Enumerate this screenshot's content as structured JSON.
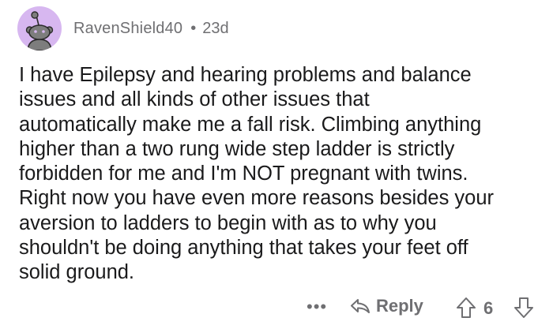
{
  "comment": {
    "author": "RavenShield40",
    "separator": "•",
    "age": "23d",
    "body_lines": [
      "I have Epilepsy and hearing problems and balance",
      "issues and all kinds of other issues that",
      "automatically make me a fall risk. Climbing anything",
      "higher than a two rung wide step ladder is strictly",
      "forbidden for me and I'm NOT pregnant with twins.",
      "Right now you have even more reasons besides your",
      "aversion to ladders to begin with as to why you",
      "shouldn't be doing anything that takes your feet off",
      "solid ground."
    ]
  },
  "actions": {
    "more_label": "•••",
    "reply_label": "Reply",
    "score": "6"
  },
  "icons": {
    "avatar": "snoo-avatar-icon",
    "reply": "reply-arrow-icon",
    "upvote": "upvote-arrow-icon",
    "downvote": "downvote-arrow-icon"
  },
  "colors": {
    "avatar_bg": "#d7b7f0",
    "meta_text": "#6f6f72",
    "body_text": "#1a1a1b"
  }
}
